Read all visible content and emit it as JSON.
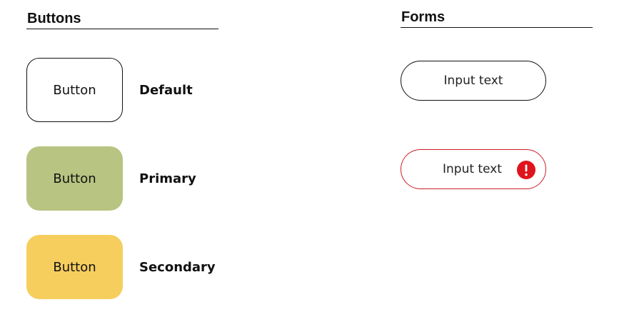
{
  "buttons_section": {
    "title": "Buttons",
    "items": [
      {
        "label": "Button",
        "caption": "Default"
      },
      {
        "label": "Button",
        "caption": "Primary"
      },
      {
        "label": "Button",
        "caption": "Secondary"
      }
    ]
  },
  "forms_section": {
    "title": "Forms",
    "inputs": [
      {
        "value": "Input text",
        "state": "default"
      },
      {
        "value": "Input text",
        "state": "error",
        "icon": "error-icon"
      }
    ]
  },
  "colors": {
    "primary": "#b7c482",
    "secondary": "#f6ce5e",
    "error": "#e0141c"
  }
}
